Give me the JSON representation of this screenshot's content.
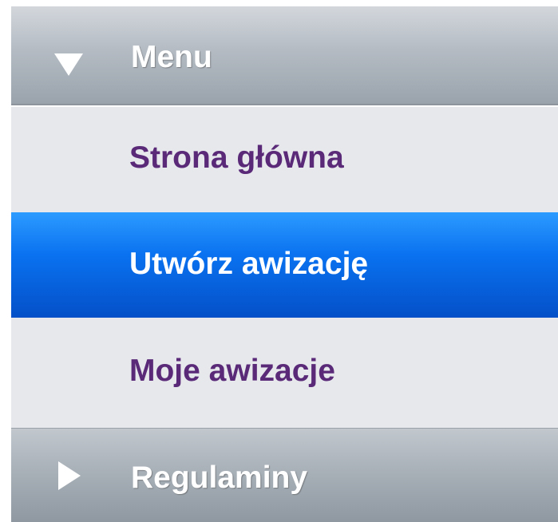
{
  "menu": {
    "header_label": "Menu",
    "header_icon": "triangle-down-icon",
    "items": [
      {
        "label": "Strona główna",
        "active": false
      },
      {
        "label": "Utwórz awizację",
        "active": true
      },
      {
        "label": "Moje awizacje",
        "active": false
      }
    ]
  },
  "regulations": {
    "header_label": "Regulaminy",
    "header_icon": "triangle-right-icon"
  },
  "colors": {
    "active_item_bg": "#0a72f0",
    "item_text": "#5a2a78",
    "item_bg": "#e6e8ec",
    "header_bg": "#b4bbc3"
  }
}
